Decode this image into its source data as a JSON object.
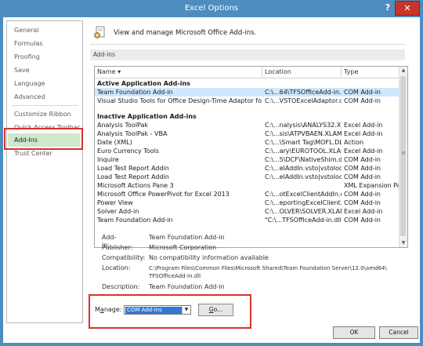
{
  "window": {
    "title": "Excel Options",
    "help_glyph": "?",
    "close_glyph": "✕",
    "colors": {
      "title_bar": "#4d8dbf",
      "close": "#c7352a",
      "highlight": "#d8332a",
      "selected_nav": "#cfe7cb"
    }
  },
  "nav": {
    "items": [
      {
        "label": "General"
      },
      {
        "label": "Formulas"
      },
      {
        "label": "Proofing"
      },
      {
        "label": "Save"
      },
      {
        "label": "Language"
      },
      {
        "label": "Advanced"
      },
      {
        "label": "Customize Ribbon"
      },
      {
        "label": "Quick Access Toolbar"
      },
      {
        "label": "Add-Ins",
        "selected": true
      },
      {
        "label": "Trust Center"
      }
    ]
  },
  "main": {
    "header_text": "View and manage Microsoft Office Add-ins.",
    "header_icon": "addins-gear-icon",
    "section_title": "Add-ins",
    "table": {
      "columns": [
        "Name ▾",
        "Location",
        "Type"
      ],
      "groups": [
        {
          "title": "Active Application Add-ins",
          "rows": [
            {
              "name": "Team Foundation Add-in",
              "location": "C:\\...64\\TFSOfficeAdd-in.dll",
              "type": "COM Add-in",
              "selected": true
            },
            {
              "name": "Visual Studio Tools for Office Design-Time Adaptor for Excel",
              "location": "C:\\...VSTOExcelAdaptor.dll",
              "type": "COM Add-in"
            }
          ]
        },
        {
          "title": "Inactive Application Add-ins",
          "rows": [
            {
              "name": "Analysis ToolPak",
              "location": "C:\\...nalysis\\ANALYS32.XLL",
              "type": "Excel Add-in"
            },
            {
              "name": "Analysis ToolPak - VBA",
              "location": "C:\\...sis\\ATPVBAEN.XLAM",
              "type": "Excel Add-in"
            },
            {
              "name": "Date (XML)",
              "location": "C:\\...\\Smart Tag\\MOFL.DLL",
              "type": "Action"
            },
            {
              "name": "Euro Currency Tools",
              "location": "C:\\...ary\\EUROTOOL.XLAM",
              "type": "Excel Add-in"
            },
            {
              "name": "Inquire",
              "location": "C:\\...5\\DCF\\NativeShim.dll",
              "type": "COM Add-in"
            },
            {
              "name": "Load Test Report Addin",
              "location": "C:\\...elAddIn.vsto|vstolocal",
              "type": "COM Add-in"
            },
            {
              "name": "Load Test Report Addin",
              "location": "C:\\...elAddIn.vsto|vstolocal",
              "type": "COM Add-in"
            },
            {
              "name": "Microsoft Actions Pane 3",
              "location": "",
              "type": "XML Expansion Pack"
            },
            {
              "name": "Microsoft Office PowerPivot for Excel 2013",
              "location": "C:\\...otExcelClientAddIn.dll",
              "type": "COM Add-in"
            },
            {
              "name": "Power View",
              "location": "C:\\...eportingExcelClient.dll",
              "type": "COM Add-in"
            },
            {
              "name": "Solver Add-in",
              "location": "C:\\...OLVER\\SOLVER.XLAM",
              "type": "Excel Add-in"
            },
            {
              "name": "Team Foundation Add-in",
              "location": "\"C:\\...TFSOfficeAdd-in.dll\"",
              "type": "COM Add-in"
            }
          ]
        }
      ]
    },
    "details": {
      "addin_label": "Add-in:",
      "addin_value": "Team Foundation Add-in",
      "publisher_label": "Publisher:",
      "publisher_value": "Microsoft Corporation",
      "compat_label": "Compatibility:",
      "compat_value": "No compatibility information available",
      "location_label": "Location:",
      "location_value_1": "C:\\Program Files\\Common Files\\Microsoft Shared\\Team Foundation Server\\12.0\\amd64\\",
      "location_value_2": "TFSOfficeAdd-in.dll",
      "description_label": "Description:",
      "description_value": "Team Foundation Add-in"
    },
    "manage": {
      "label_pre": "M",
      "label_ul": "a",
      "label_post": "nage:",
      "selected": "COM Add-ins",
      "go_ul": "G",
      "go_post": "o..."
    }
  },
  "footer": {
    "ok_label": "OK",
    "cancel_label": "Cancel"
  }
}
